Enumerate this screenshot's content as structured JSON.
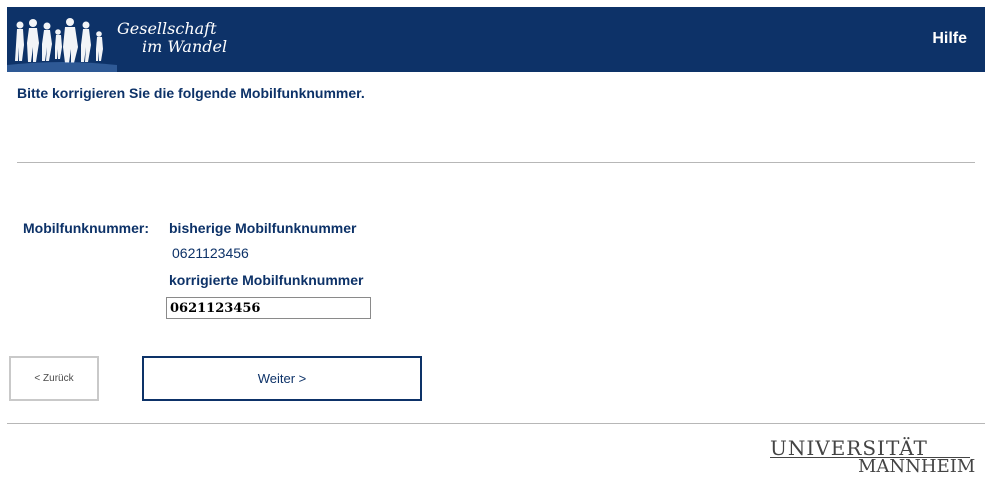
{
  "header": {
    "logo_text_line1": "Gesellschaft",
    "logo_text_line2": "im Wandel",
    "help_label": "Hilfe",
    "background_color": "#0d3268"
  },
  "main": {
    "question": "Bitte korrigieren Sie die folgende Mobilfunknummer.",
    "field_label": "Mobilfunknummer:",
    "previous_label": "bisherige Mobilfunknummer",
    "previous_value": "0621123456",
    "corrected_label": "korrigierte Mobilfunknummer",
    "corrected_value": "0621123456"
  },
  "navigation": {
    "back_label": "< Zurück",
    "next_label": "Weiter >"
  },
  "footer": {
    "university_line1": "UNIVERSITÄT",
    "university_line2": "MANNHEIM"
  },
  "icons": {
    "logo_graphic": "people-silhouettes-icon"
  }
}
